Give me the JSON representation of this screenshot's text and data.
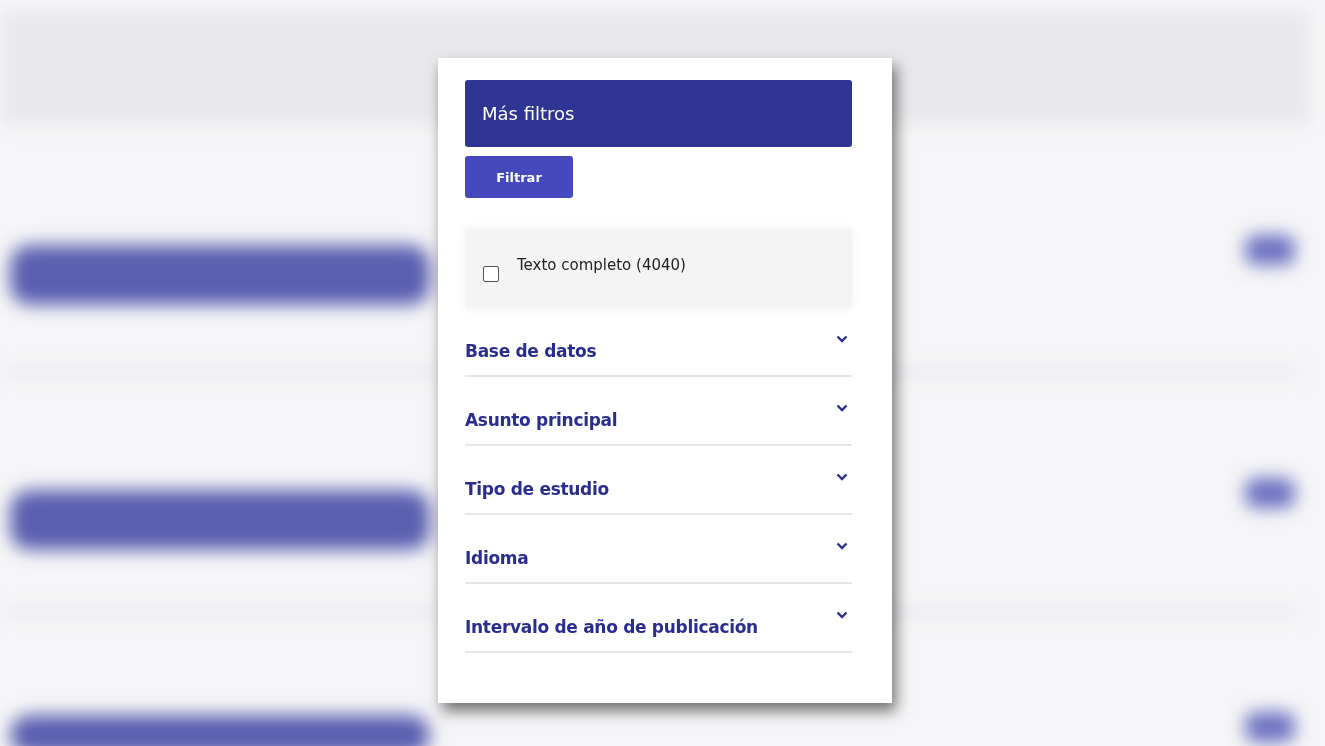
{
  "panel": {
    "title": "Más filtros",
    "filter_button": "Filtrar",
    "checkbox": {
      "label": "Texto completo (4040)",
      "checked": false
    },
    "sections": [
      {
        "label": "Base de datos",
        "expanded": false
      },
      {
        "label": "Asunto principal",
        "expanded": false
      },
      {
        "label": "Tipo de estudio",
        "expanded": false
      },
      {
        "label": "Idioma",
        "expanded": false
      },
      {
        "label": "Intervalo de año de publicación",
        "expanded": false
      }
    ]
  }
}
